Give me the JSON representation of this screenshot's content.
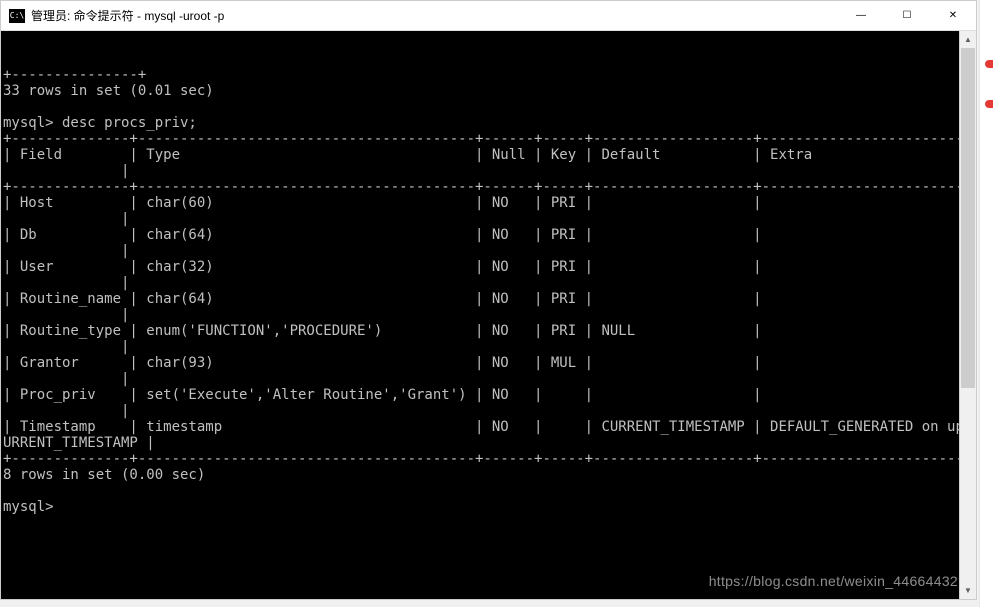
{
  "titlebar": {
    "icon_text": "C:\\",
    "title": "管理员: 命令提示符 - mysql  -uroot -p"
  },
  "window_controls": {
    "minimize": "—",
    "maximize": "☐",
    "close": "✕"
  },
  "terminal": {
    "line1": "+---------------+",
    "line2": "33 rows in set (0.01 sec)",
    "blank1": "",
    "prompt1": "mysql> desc procs_priv;",
    "border_top": "+--------------+----------------------------------------+------+-----+-------------------+-----------------------------------------------+",
    "header": "| Field        | Type                                   | Null | Key | Default           | Extra                                         |",
    "header2": "              |",
    "border_mid": "+--------------+----------------------------------------+------+-----+-------------------+-----------------------------------------------+",
    "row1": "| Host         | char(60)                               | NO   | PRI |                   |                                               |",
    "row1b": "              |",
    "row2": "| Db           | char(64)                               | NO   | PRI |                   |                                               |",
    "row2b": "              |",
    "row3": "| User         | char(32)                               | NO   | PRI |                   |                                               |",
    "row3b": "              |",
    "row4": "| Routine_name | char(64)                               | NO   | PRI |                   |                                               |",
    "row4b": "              |",
    "row5": "| Routine_type | enum('FUNCTION','PROCEDURE')           | NO   | PRI | NULL              |                                               |",
    "row5b": "              |",
    "row6": "| Grantor      | char(93)                               | NO   | MUL |                   |                                               |",
    "row6b": "              |",
    "row7": "| Proc_priv    | set('Execute','Alter Routine','Grant') | NO   |     |                   |                                               |",
    "row7b": "              |",
    "row8": "| Timestamp    | timestamp                              | NO   |     | CURRENT_TIMESTAMP | DEFAULT_GENERATED on update C",
    "row8b": "URRENT_TIMESTAMP |",
    "border_bot": "+--------------+----------------------------------------+------+-----+-------------------+-----------------------------------------------+",
    "summary": "8 rows in set (0.00 sec)",
    "blank2": "",
    "prompt2": "mysql>"
  },
  "watermark": "https://blog.csdn.net/weixin_44664432",
  "chart_data": {
    "type": "table",
    "title": "desc procs_priv",
    "columns": [
      "Field",
      "Type",
      "Null",
      "Key",
      "Default",
      "Extra"
    ],
    "rows": [
      {
        "Field": "Host",
        "Type": "char(60)",
        "Null": "NO",
        "Key": "PRI",
        "Default": "",
        "Extra": ""
      },
      {
        "Field": "Db",
        "Type": "char(64)",
        "Null": "NO",
        "Key": "PRI",
        "Default": "",
        "Extra": ""
      },
      {
        "Field": "User",
        "Type": "char(32)",
        "Null": "NO",
        "Key": "PRI",
        "Default": "",
        "Extra": ""
      },
      {
        "Field": "Routine_name",
        "Type": "char(64)",
        "Null": "NO",
        "Key": "PRI",
        "Default": "",
        "Extra": ""
      },
      {
        "Field": "Routine_type",
        "Type": "enum('FUNCTION','PROCEDURE')",
        "Null": "NO",
        "Key": "PRI",
        "Default": "NULL",
        "Extra": ""
      },
      {
        "Field": "Grantor",
        "Type": "char(93)",
        "Null": "NO",
        "Key": "MUL",
        "Default": "",
        "Extra": ""
      },
      {
        "Field": "Proc_priv",
        "Type": "set('Execute','Alter Routine','Grant')",
        "Null": "NO",
        "Key": "",
        "Default": "",
        "Extra": ""
      },
      {
        "Field": "Timestamp",
        "Type": "timestamp",
        "Null": "NO",
        "Key": "",
        "Default": "CURRENT_TIMESTAMP",
        "Extra": "DEFAULT_GENERATED on update CURRENT_TIMESTAMP"
      }
    ],
    "previous_result": "33 rows in set (0.01 sec)",
    "result_summary": "8 rows in set (0.00 sec)"
  }
}
